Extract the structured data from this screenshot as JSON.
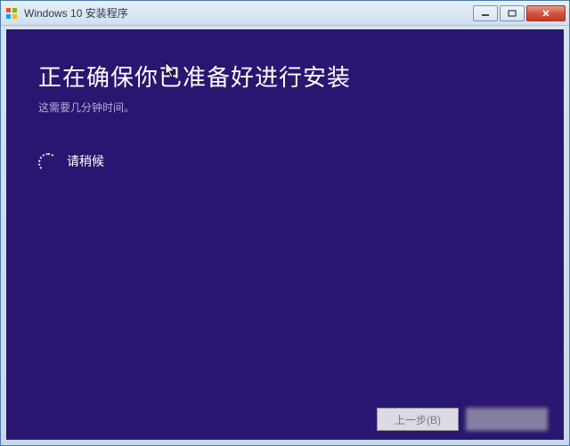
{
  "window": {
    "title": "Windows 10 安装程序"
  },
  "content": {
    "heading": "正在确保你已准备好进行安装",
    "subtext": "这需要几分钟时间。",
    "wait_label": "请稍候"
  },
  "footer": {
    "back_label": "上一步(B)"
  }
}
